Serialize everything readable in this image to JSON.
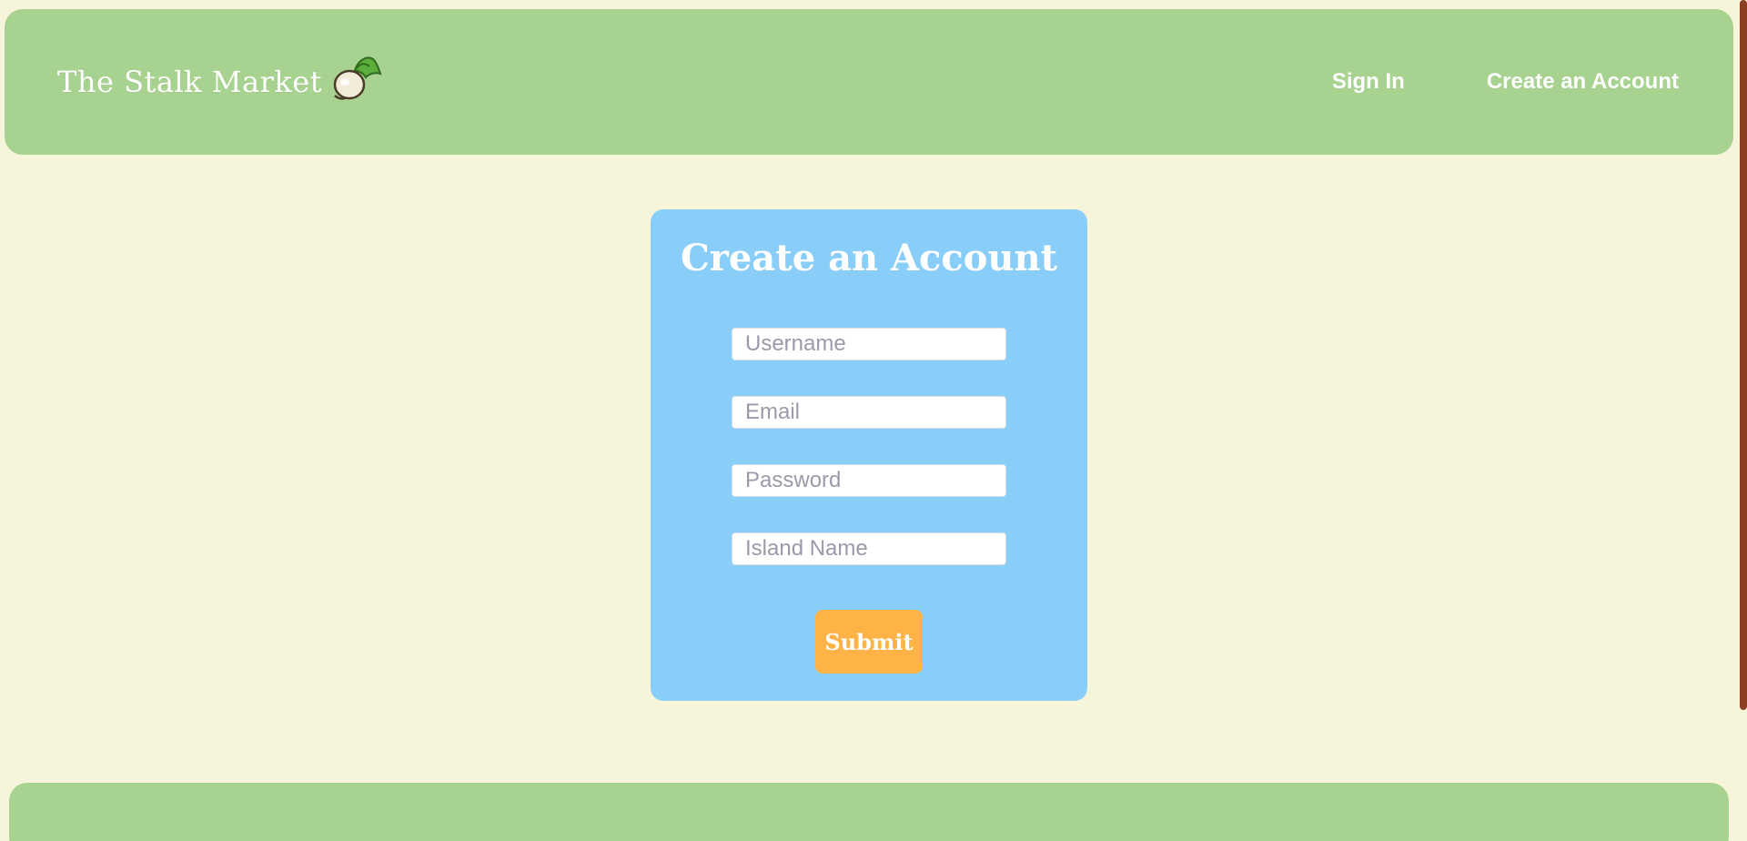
{
  "navbar": {
    "brand": "The Stalk Market",
    "brand_icon": "turnip-icon",
    "links": {
      "sign_in": "Sign In",
      "create_account": "Create an Account"
    }
  },
  "form": {
    "title": "Create an Account",
    "fields": {
      "username": {
        "placeholder": "Username",
        "value": ""
      },
      "email": {
        "placeholder": "Email",
        "value": ""
      },
      "password": {
        "placeholder": "Password",
        "value": ""
      },
      "island_name": {
        "placeholder": "Island Name",
        "value": ""
      }
    },
    "submit_label": "Submit"
  },
  "colors": {
    "background": "#f6f5dc",
    "navbar": "#a8d28f",
    "card": "#89cdf9",
    "submit": "#ffb347",
    "scrollbar": "#8b3e22"
  }
}
